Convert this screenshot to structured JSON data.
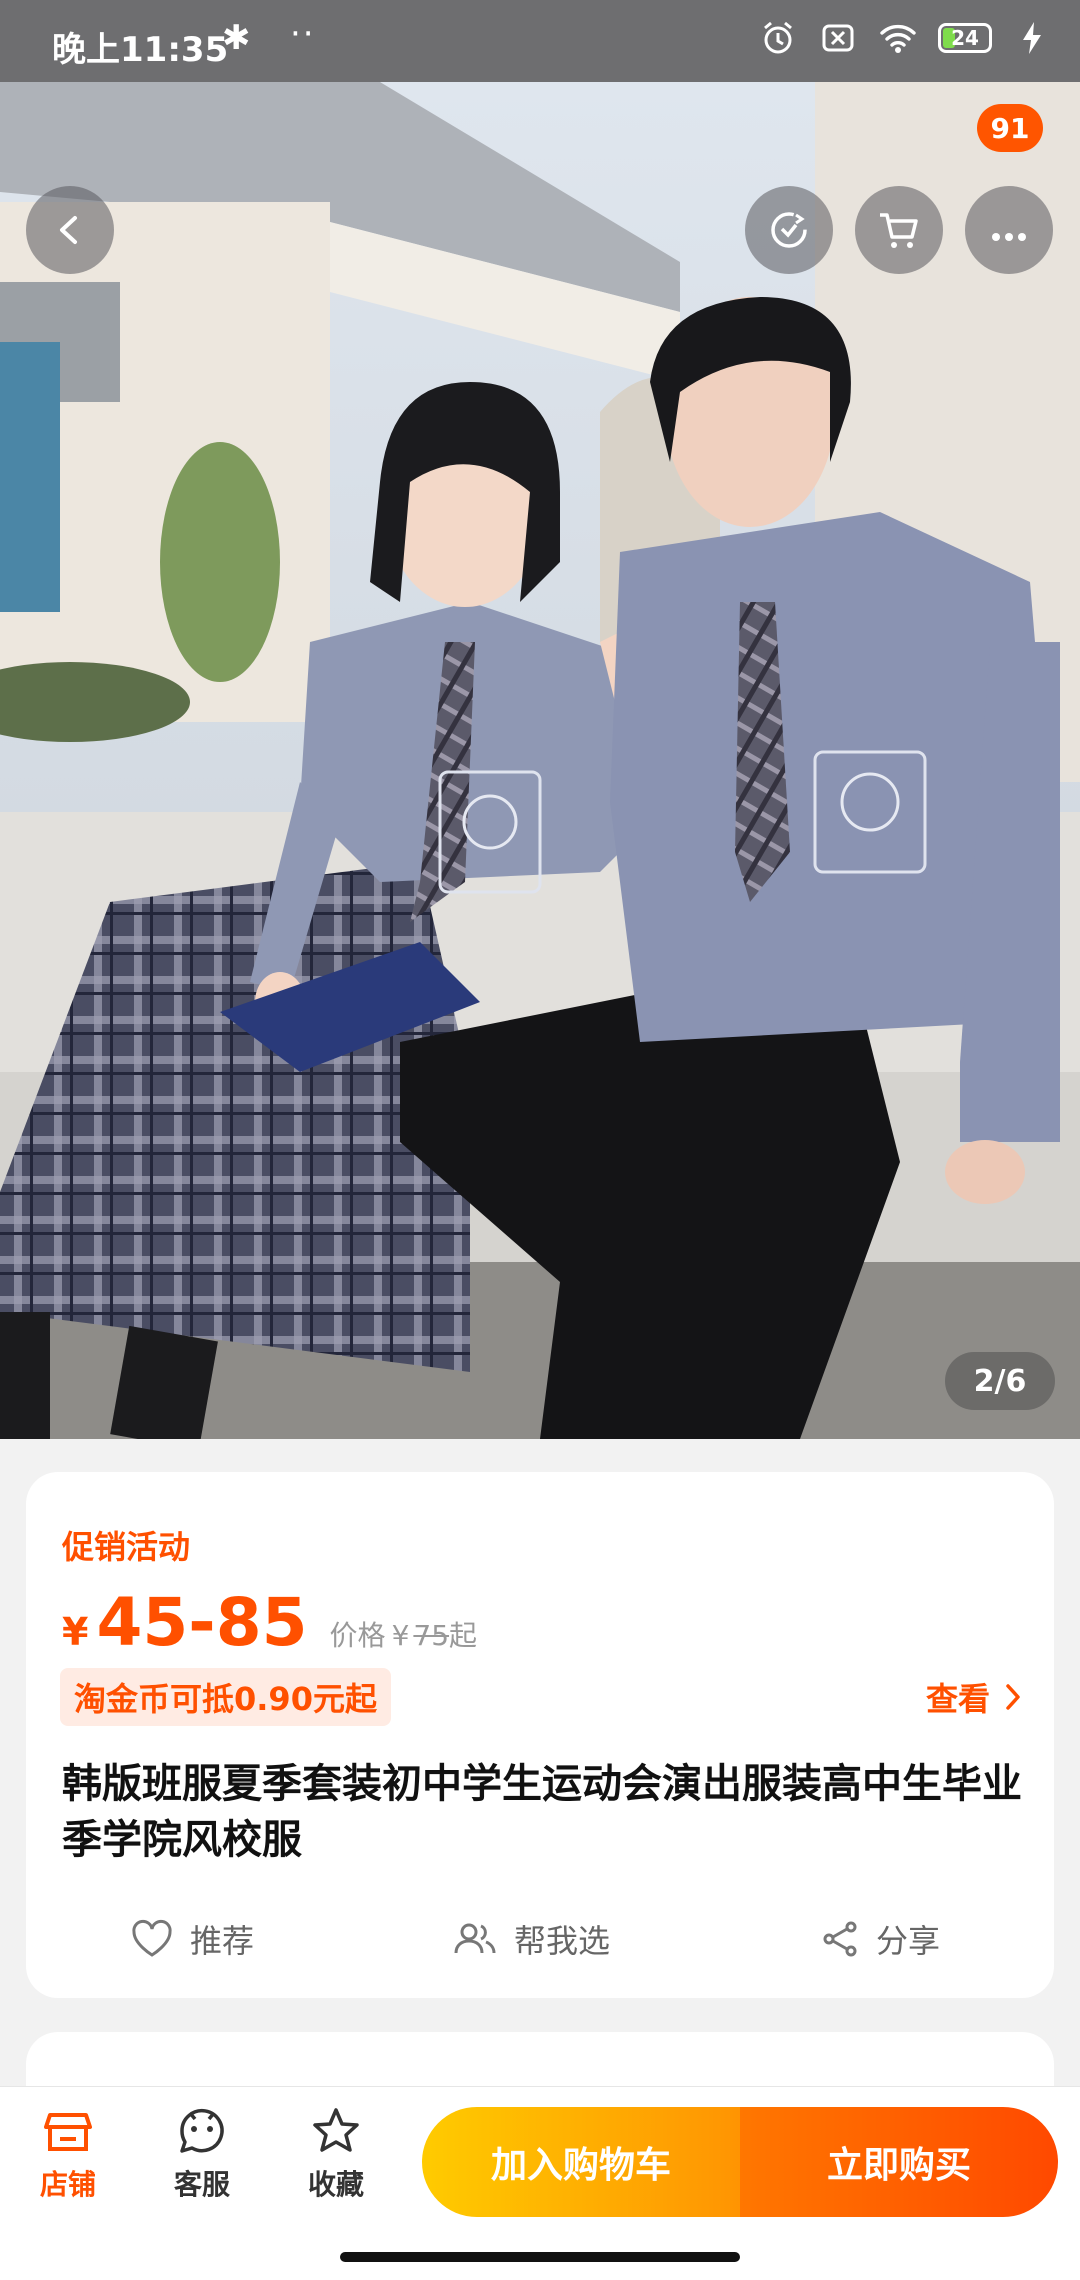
{
  "status_bar": {
    "time": "晚上11:35",
    "bluetooth_icon": "bluetooth-icon",
    "dots": "··",
    "battery_level": "24",
    "icons": [
      "alarm-icon",
      "sim-off-icon",
      "wifi-icon",
      "battery-icon",
      "charging-icon"
    ]
  },
  "gallery": {
    "page_indicator": "2/6",
    "cart_badge": "91",
    "nav_icons": [
      "back-icon",
      "ar-rotate-icon",
      "cart-icon",
      "more-icon"
    ]
  },
  "product": {
    "promo_label": "促销活动",
    "currency": "¥",
    "price_range": "45-85",
    "price_label": "价格",
    "original_price": "75",
    "original_suffix": "起",
    "coin_offer": "淘金币可抵0.90元起",
    "view_link": "查看",
    "title": "韩版班服夏季套装初中学生运动会演出服装高中生毕业季学院风校服"
  },
  "actions": {
    "recommend": "推荐",
    "help_choose": "帮我选",
    "share": "分享"
  },
  "bottom_bar": {
    "store": "店铺",
    "service": "客服",
    "favorite": "收藏",
    "add_to_cart": "加入购物车",
    "buy_now": "立即购买"
  },
  "colors": {
    "accent": "#ff5000",
    "cart_gradient": [
      "#ffcb00",
      "#ff9402"
    ],
    "buy_gradient": [
      "#ff7700",
      "#ff4900"
    ]
  }
}
